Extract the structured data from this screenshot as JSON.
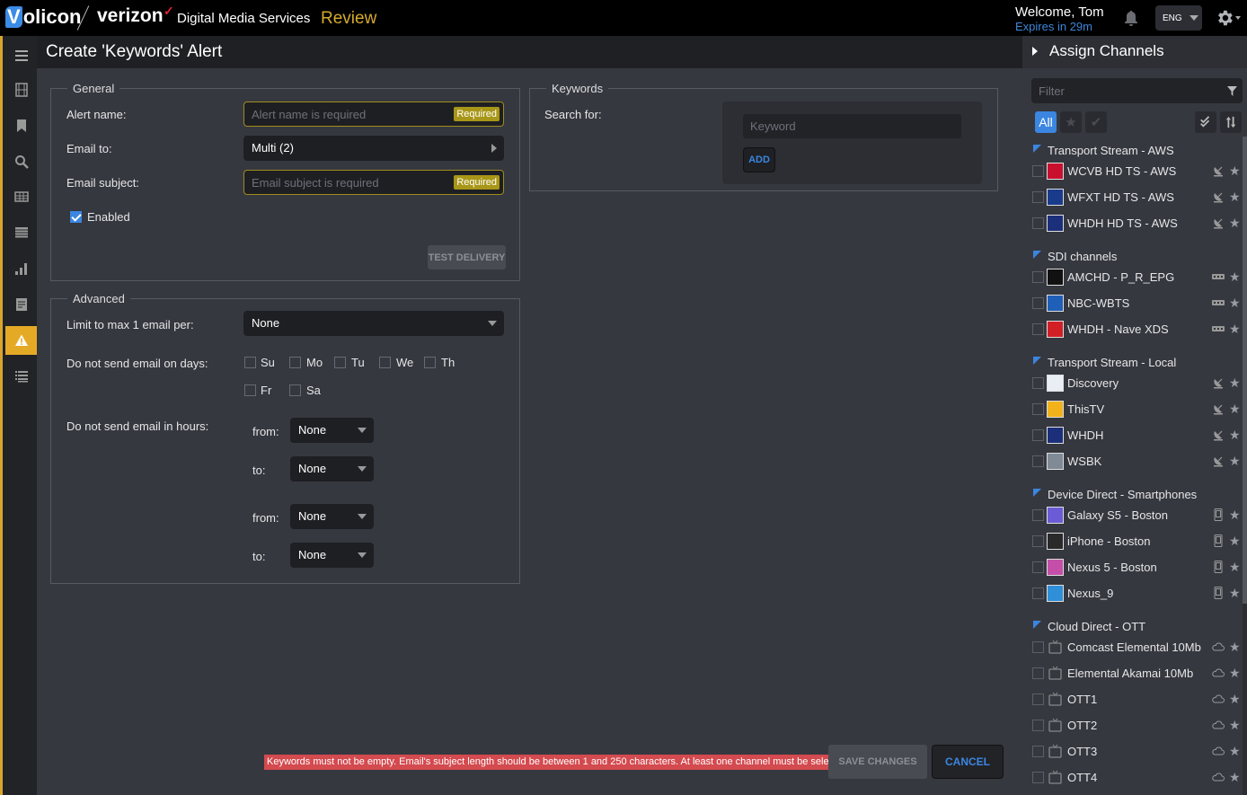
{
  "header": {
    "brand_left": "olicon",
    "brand_v": "V",
    "brand_right": "verizon",
    "brand_check": "✓",
    "product": "Digital Media Services",
    "mode": "Review",
    "welcome": "Welcome, Tom",
    "expires": "Expires in 29m",
    "language": "ENG",
    "icons": [
      "bell-icon",
      "gear-icon"
    ]
  },
  "nav": {
    "items": [
      "menu",
      "clips",
      "bookmarks",
      "search",
      "grid",
      "table",
      "reports",
      "notes",
      "alerts",
      "list"
    ],
    "active": "alerts"
  },
  "page": {
    "title": "Create 'Keywords' Alert"
  },
  "general": {
    "legend": "General",
    "alert_name_label": "Alert name:",
    "alert_name_placeholder": "Alert name is required",
    "required_badge": "Required",
    "email_to_label": "Email to:",
    "email_to_value": "Multi (2)",
    "email_subject_label": "Email subject:",
    "email_subject_placeholder": "Email subject is required",
    "enabled_label": "Enabled",
    "enabled_checked": true,
    "test_delivery": "TEST DELIVERY"
  },
  "keywords": {
    "legend": "Keywords",
    "search_for_label": "Search for:",
    "keyword_placeholder": "Keyword",
    "add_button": "ADD"
  },
  "advanced": {
    "legend": "Advanced",
    "limit_label": "Limit to max 1 email per:",
    "limit_value": "None",
    "days_label": "Do not send email on days:",
    "days": [
      {
        "label": "Su",
        "checked": false
      },
      {
        "label": "Mo",
        "checked": false
      },
      {
        "label": "Tu",
        "checked": false
      },
      {
        "label": "We",
        "checked": false
      },
      {
        "label": "Th",
        "checked": false
      },
      {
        "label": "Fr",
        "checked": false
      },
      {
        "label": "Sa",
        "checked": false
      }
    ],
    "hours_label": "Do not send email in hours:",
    "hours": [
      {
        "label": "from:",
        "value": "None"
      },
      {
        "label": "to:",
        "value": "None"
      },
      {
        "label": "from:",
        "value": "None"
      },
      {
        "label": "to:",
        "value": "None"
      }
    ]
  },
  "footer": {
    "error": "Keywords must not be empty. Email's subject length should be between 1 and 250 characters. At least one channel must be selected",
    "save": "SAVE CHANGES",
    "cancel": "CANCEL"
  },
  "channels": {
    "title": "Assign Channels",
    "filter_placeholder": "Filter",
    "all_label": "All",
    "groups": [
      {
        "name": "Transport Stream - AWS",
        "type": "satellite",
        "items": [
          {
            "name": "WCVB HD TS - AWS",
            "logo_color": "#c8102e"
          },
          {
            "name": "WFXT HD TS - AWS",
            "logo_color": "#1a3b8c"
          },
          {
            "name": "WHDH HD TS - AWS",
            "logo_color": "#1b2f7a"
          }
        ]
      },
      {
        "name": "SDI channels",
        "type": "sdi",
        "items": [
          {
            "name": "AMCHD - P_R_EPG",
            "logo_color": "#111111"
          },
          {
            "name": "NBC-WBTS",
            "logo_color": "#1f5fb8"
          },
          {
            "name": "WHDH - Nave XDS",
            "logo_color": "#d21f26"
          }
        ]
      },
      {
        "name": "Transport Stream - Local",
        "type": "satellite",
        "items": [
          {
            "name": "Discovery",
            "logo_color": "#e9eef4"
          },
          {
            "name": "ThisTV",
            "logo_color": "#f2b21c"
          },
          {
            "name": "WHDH",
            "logo_color": "#1b2f7a"
          },
          {
            "name": "WSBK",
            "logo_color": "#7f8a96"
          }
        ]
      },
      {
        "name": "Device Direct - Smartphones",
        "type": "device",
        "items": [
          {
            "name": "Galaxy S5 - Boston",
            "logo_color": "#6b5bd6"
          },
          {
            "name": "iPhone - Boston",
            "logo_color": "#2a2a2a"
          },
          {
            "name": "Nexus 5 - Boston",
            "logo_color": "#c44fa8"
          },
          {
            "name": "Nexus_9",
            "logo_color": "#2f8fd8"
          }
        ]
      },
      {
        "name": "Cloud Direct - OTT",
        "type": "cloud",
        "items": [
          {
            "name": "Comcast Elemental 10Mb",
            "logo_color": ""
          },
          {
            "name": "Elemental Akamai 10Mb",
            "logo_color": ""
          },
          {
            "name": "OTT1",
            "logo_color": ""
          },
          {
            "name": "OTT2",
            "logo_color": ""
          },
          {
            "name": "OTT3",
            "logo_color": ""
          },
          {
            "name": "OTT4",
            "logo_color": ""
          }
        ]
      }
    ]
  },
  "colors": {
    "accent": "#3b86e0",
    "warning": "#e5aa25",
    "required": "#a89618",
    "error": "#d34a4f"
  }
}
